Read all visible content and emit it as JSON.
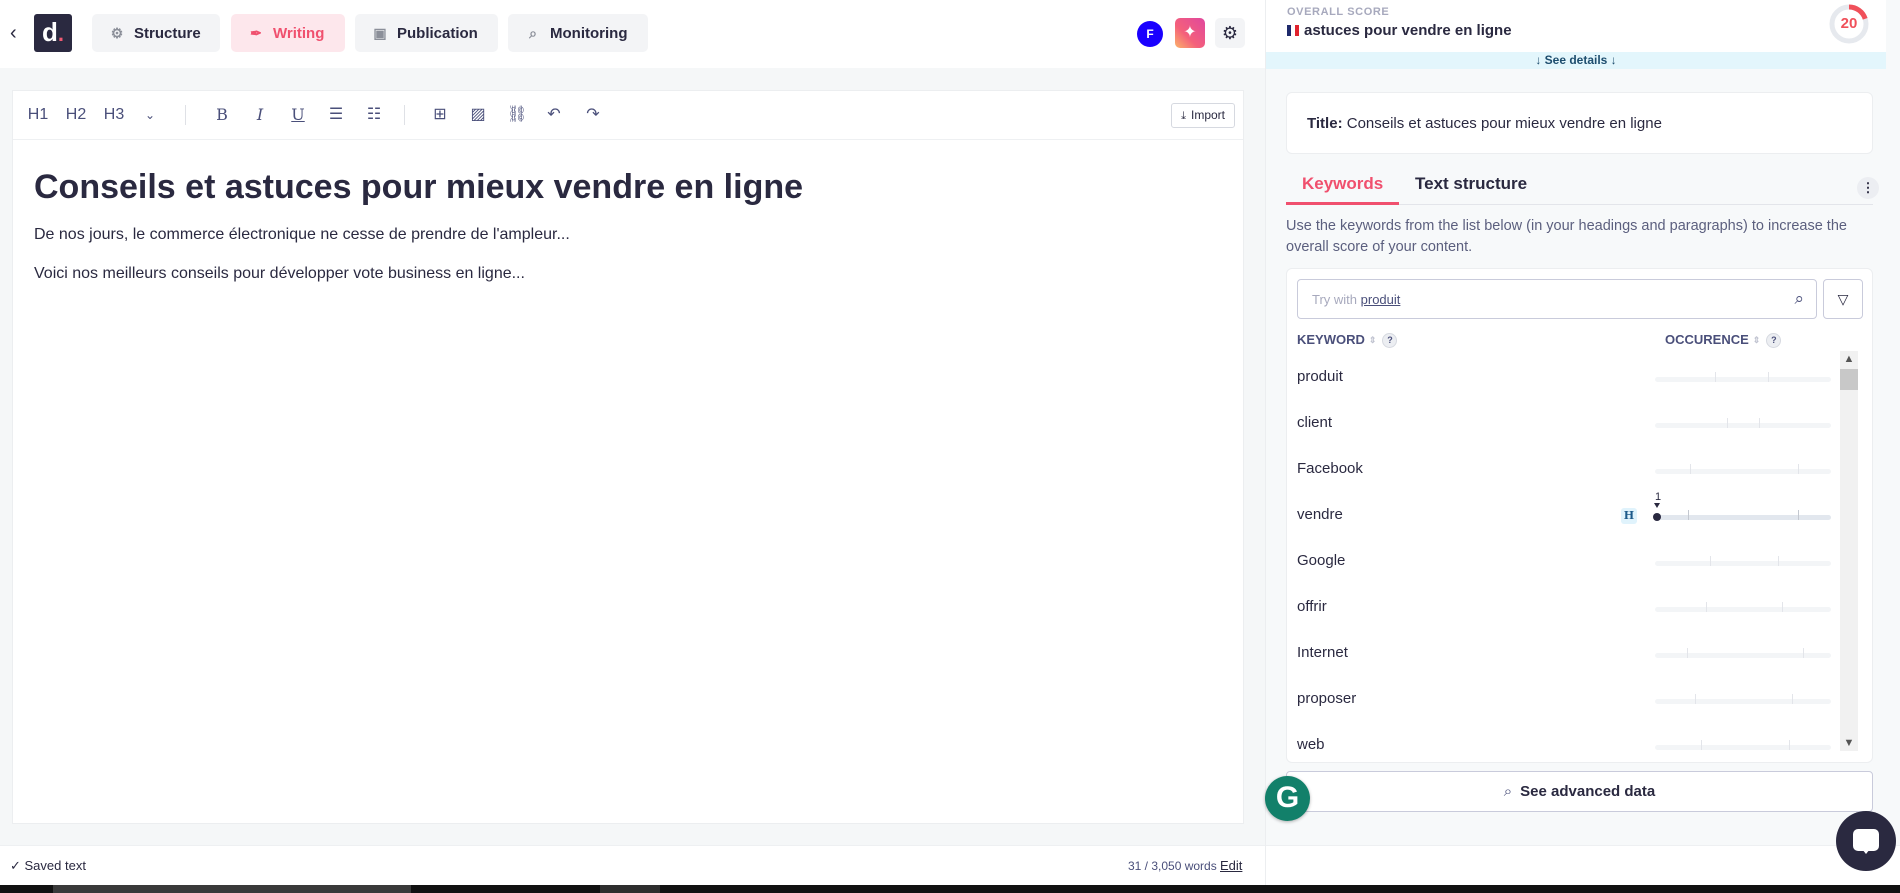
{
  "header": {
    "back_icon": "chevron-left-icon",
    "logo_text": "d",
    "logo_dot": ".",
    "nav": [
      {
        "label": "Structure",
        "icon": "gear-icon",
        "active": false
      },
      {
        "label": "Writing",
        "icon": "feather-icon",
        "active": true
      },
      {
        "label": "Publication",
        "icon": "publish-icon",
        "active": false
      },
      {
        "label": "Monitoring",
        "icon": "monitoring-icon",
        "active": false
      }
    ],
    "avatar_initial": "F",
    "ai_icon": "sparkles-icon",
    "settings_icon": "gear-icon"
  },
  "toolbar": {
    "h1": "H1",
    "h2": "H2",
    "h3": "H3",
    "more_icon": "chevron-down-icon",
    "bold": "B",
    "italic": "I",
    "underline": "U",
    "import_label": "Import"
  },
  "document": {
    "title": "Conseils et astuces pour mieux vendre en ligne",
    "paragraphs": [
      "De nos jours, le commerce électronique ne cesse de prendre de l'ampleur...",
      "Voici nos meilleurs conseils pour développer vote business en ligne..."
    ]
  },
  "status": {
    "saved": "✓ Saved text",
    "words": "31 / 3,050 words",
    "edit_label": "Edit"
  },
  "score": {
    "label": "OVERALL SCORE",
    "keyword": "astuces pour vendre en ligne",
    "language": "fr",
    "value": "20",
    "value_fraction": 0.2,
    "see_details": "↓ See details ↓",
    "ring_color": "#f0505a"
  },
  "panel": {
    "title_prefix": "Title:",
    "title_value": " Conseils et astuces pour mieux vendre en ligne",
    "tabs": [
      {
        "label": "Keywords",
        "active": true
      },
      {
        "label": "Text structure",
        "active": false
      }
    ],
    "hint": "Use the keywords from the list below (in your headings and paragraphs) to increase the overall score of your content.",
    "search_placeholder_prefix": "Try with ",
    "search_suggestion": "produit",
    "col_keyword": "KEYWORD",
    "col_occurence": "OCCURENCE",
    "help": "?",
    "advanced_label": "See advanced data",
    "keywords": [
      {
        "name": "produit",
        "count": null,
        "heading": false,
        "ticks": [
          0.34,
          0.64
        ]
      },
      {
        "name": "client",
        "count": null,
        "heading": false,
        "ticks": [
          0.41,
          0.59
        ]
      },
      {
        "name": "Facebook",
        "count": null,
        "heading": false,
        "ticks": [
          0.2,
          0.81
        ]
      },
      {
        "name": "vendre",
        "count": "1",
        "heading": true,
        "ticks": [
          0.19,
          0.81
        ]
      },
      {
        "name": "Google",
        "count": null,
        "heading": false,
        "ticks": [
          0.31,
          0.7
        ]
      },
      {
        "name": "offrir",
        "count": null,
        "heading": false,
        "ticks": [
          0.29,
          0.72
        ]
      },
      {
        "name": "Internet",
        "count": null,
        "heading": false,
        "ticks": [
          0.18,
          0.84
        ]
      },
      {
        "name": "proposer",
        "count": null,
        "heading": false,
        "ticks": [
          0.23,
          0.78
        ]
      },
      {
        "name": "web",
        "count": null,
        "heading": false,
        "ticks": [
          0.26,
          0.76
        ]
      }
    ]
  },
  "accent": "#f0506e"
}
